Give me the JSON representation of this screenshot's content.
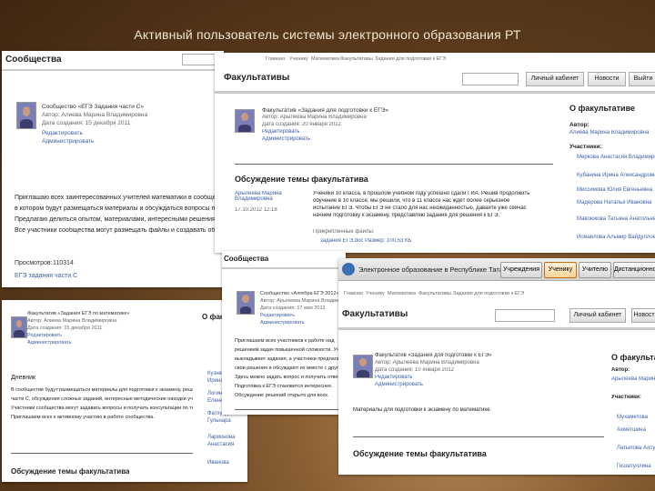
{
  "slide": {
    "title": "Активный пользователь системы электронного образования РТ"
  },
  "left_window": {
    "header": "Сообщества",
    "entry": {
      "title": "Сообщество «ЕГЭ Задания части С»",
      "author": "Автор: Алиева Марина Владимировна",
      "date": "Дата создания: 15 декабря 2011",
      "edit": "Редактировать",
      "admin": "Администрировать"
    },
    "body_lines": [
      "Приглашаю всех заинтересованных учителей математики в сообщество «ЕГЭ Задания части С»,",
      "в котором будут размещаться материалы и обсуждаться вопросы подготовки к ЕГЭ по математике.",
      "Предлагаю делиться опытом, материалами, интересными решениями задач.",
      "Все участники сообщества могут размещать файлы и создавать обсуждения."
    ],
    "views_label": "Просмотров:",
    "views_value": "110314",
    "extra_link": "ЕГЭ задания части С"
  },
  "middle_window": {
    "breadcrumbs": [
      "Главная",
      "Ученику",
      "Математика",
      "Факультативы",
      "Задания для подготовки к ЕГЭ"
    ],
    "header": "Факультативы",
    "buttons": [
      "Личный кабинет",
      "Новости",
      "Выйти"
    ],
    "entry": {
      "title": "Факультатив «Задания для подготовки к ЕГЭ»",
      "author": "Автор: Арылеева Марина Владимировна",
      "date": "Дата создания: 20 января 2012",
      "edit": "Редактировать",
      "admin": "Администрировать"
    },
    "discussion_title": "Обсуждение темы факультатива",
    "post": {
      "author": "Арылеева Марина Владимировна",
      "date": "17.10.2012 12:18",
      "lines": [
        "Ученики 10 класса, в прошлом учебном году успешно сдали ГИА. Решив продолжить",
        "обучение в 10 классе, мы решили, что в 11 классе нас ждёт более серьёзное",
        "испытание ЕГЭ. Чтобы ЕГЭ не стало для нас неожиданностью, давайте уже сейчас",
        "начнём подготовку к экзамену, представляю задания для решения к ЕГЭ."
      ],
      "attach_label": "Прикреплённые файлы:",
      "attach_file": "задания ЕГЭ.doc  Размер: 100,53 КБ"
    },
    "side": {
      "title": "О факультативе",
      "author_label": "Автор:",
      "author_value": "Алиева Марина Владимировна",
      "members_label": "Участники:",
      "members": [
        "Меркова Анастасия Владимировна",
        "Кубанина Ирина Александровна",
        "Миссимова Юлия Евгеньевна",
        "Мадерова Наталья Ивановна",
        "Мавлюкова Татьяна Анатольевна",
        "Исмаилова Альмир Вайдуллоевна"
      ]
    }
  },
  "lower_left_window": {
    "header": "Сообщества",
    "entry": {
      "title": "Факультатив «Задания ЕГЭ по математике»",
      "author": "Автор: Алиева Марина Владимировна",
      "date": "Дата создания: 15 декабря 2011",
      "edit": "Редактировать",
      "admin": "Администрировать"
    },
    "diary": "Дневник",
    "body_lines": [
      "В сообществе будут размещаться материалы для подготовки к экзамену, решения задач",
      "части С, обсуждения сложных заданий, интересные методические находки учителей.",
      "Участники сообщества могут задавать вопросы и получать консультации по темам.",
      "Приглашаем всех к активному участию в работе сообщества."
    ],
    "discussion_title": "Обсуждение темы факультатива",
    "side": {
      "title": "О факультативе",
      "members": [
        "Кузнецова",
        "Ирина",
        "Логинова",
        "Елена",
        "Фатхутдинова",
        "Гульнара",
        "Ларионова",
        "Анастасия",
        "Иванова"
      ]
    }
  },
  "center_window": {
    "header": "Сообщества",
    "entry": {
      "title": "Сообщество «Алгебра ЕГЭ 2012»",
      "author": "Автор: Арылеева Марина Владимировна",
      "date": "Дата создания: 17 мая 2012",
      "edit": "Редактировать",
      "admin": "Администрировать"
    },
    "body_lines": [
      "Приглашаем всех участников к работе над",
      "решением задач повышенной сложности. Учитель",
      "выкладывает задания, а участники предлагают",
      "свои решения и обсуждают их вместе с другими.",
      "Здесь можно задать вопрос и получить ответ.",
      "Подготовка к ЕГЭ становится интереснее.",
      "Обсуждение решений открыто для всех."
    ]
  },
  "front_window": {
    "app_title": "Электронное образование в Республике Татарстан",
    "tabs": [
      "Учреждения",
      "Ученику",
      "Учителю",
      "Дистанционному"
    ],
    "breadcrumbs": [
      "Главная",
      "Ученику",
      "Математика",
      "Факультативы",
      "Задания для подготовки к ЕГЭ"
    ],
    "header": "Факультативы",
    "buttons": [
      "Личный кабинет",
      "Новости"
    ],
    "entry": {
      "title": "Факультатив «Задания для подготовки к ЕГЭ»",
      "author": "Автор: Арылеева Марина Владимировна",
      "date": "Дата создания: 10 января 2012",
      "edit": "Редактировать",
      "admin": "Администрировать"
    },
    "body_line": "Материалы для подготовки к экзамену по математике.",
    "discussion_title": "Обсуждение темы факультатива",
    "side": {
      "title": "О факультативе",
      "author_label": "Автор:",
      "author_value": "Арылеева Марина",
      "members_label": "Участники:",
      "members": [
        "Мухаметова",
        "Ахметшина",
        "Латыпова Алсу",
        "Гиззатуллина"
      ]
    }
  }
}
